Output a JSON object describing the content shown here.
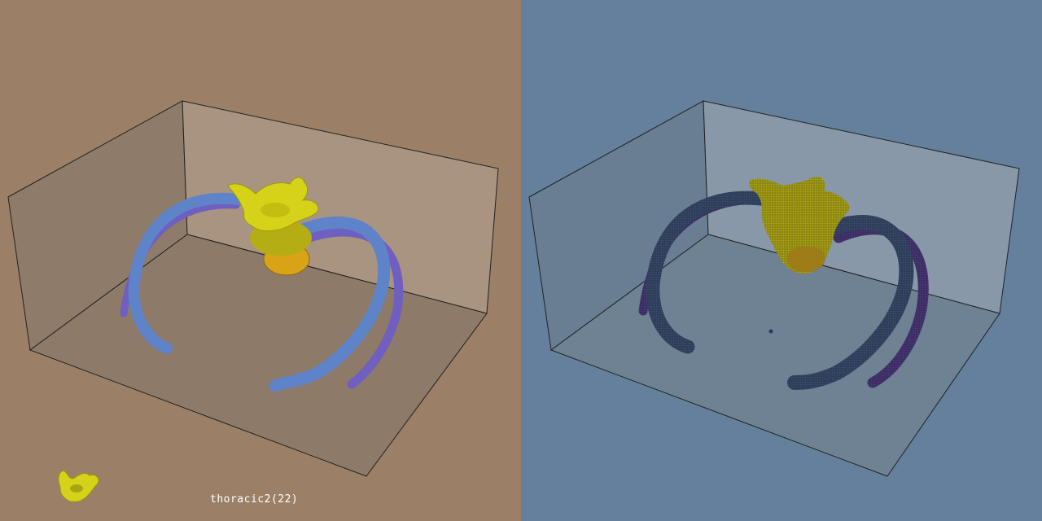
{
  "caption": "thoracic2(22)",
  "colors": {
    "left_background": "#9b8067",
    "right_background": "#64809c",
    "vertebra": "#d6d21a",
    "vertebra_lower": "#d9a317",
    "rib_front": "#5f83c8",
    "rib_back": "#6e5fc0",
    "points_rib": "#2e3d58",
    "points_rib_back": "#3c2e64",
    "points_vertebra": "#9a9416"
  },
  "icons": {
    "thumbnail": "vertebra-thumbnail-icon"
  }
}
